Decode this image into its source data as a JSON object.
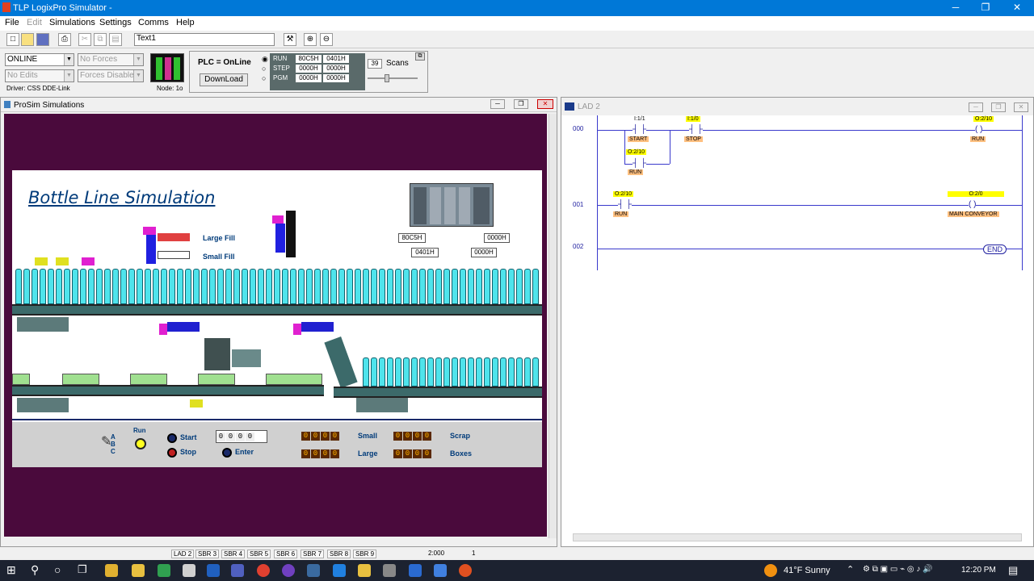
{
  "window": {
    "title": "TLP LogixPro Simulator  -"
  },
  "menu": [
    "File",
    "Edit",
    "Simulations",
    "Settings",
    "Comms",
    "Help"
  ],
  "toolbar": {
    "text_field": "Text1"
  },
  "status": {
    "mode": "ONLINE",
    "forces": "No Forces",
    "edits": "No Edits",
    "forces_disabled": "Forces Disabled",
    "driver": "Driver: CSS DDE-Link",
    "node": "Node: 1o",
    "plc": "PLC = OnLine",
    "download": "DownLoad",
    "run": "RUN",
    "step": "STEP",
    "pgm": "PGM",
    "hex": [
      "80C5H",
      "0401H",
      "0000H",
      "0000H",
      "0000H",
      "0000H"
    ],
    "scans_value": "39",
    "scans_label": "Scans"
  },
  "prosim": {
    "title": "ProSim Simulations",
    "sim_title": "Bottle Line Simulation",
    "large_fill": "Large Fill",
    "small_fill": "Small Fill",
    "plc_hex": [
      "80C5H",
      "0000H",
      "0401H",
      "0000H"
    ],
    "panel": {
      "run": "Run",
      "start": "Start",
      "stop": "Stop",
      "enter": "Enter",
      "small": "Small",
      "large": "Large",
      "scrap": "Scrap",
      "boxes": "Boxes",
      "abc": [
        "A",
        "B",
        "C"
      ],
      "thumbwheel": [
        "0",
        "0",
        "0",
        "0"
      ],
      "small_count": [
        "0",
        "0",
        "0",
        "0"
      ],
      "large_count": [
        "0",
        "0",
        "0",
        "0"
      ],
      "scrap_count": [
        "0",
        "0",
        "0",
        "0"
      ],
      "boxes_count": [
        "0",
        "0",
        "0",
        "0"
      ]
    }
  },
  "ladder": {
    "title": "LAD 2",
    "rungs": [
      "000",
      "001",
      "002"
    ],
    "r0": {
      "start_addr": "I:1/1",
      "start": "START",
      "stop_addr": "I:1/0",
      "stop": "STOP",
      "seal_addr": "O:2/10",
      "seal": "RUN",
      "coil_addr": "O:2/10",
      "coil": "RUN"
    },
    "r1": {
      "c_addr": "O:2/10",
      "c": "RUN",
      "coil_addr": "O:2/0",
      "coil": "MAIN CONVEYOR"
    },
    "end": "END"
  },
  "tabs": [
    "LAD 2",
    "SBR 3",
    "SBR 4",
    "SBR 5",
    "SBR 6",
    "SBR 7",
    "SBR 8",
    "SBR 9"
  ],
  "statusbar": {
    "address": "2:000",
    "value": "1"
  },
  "taskbar": {
    "weather": "41°F  Sunny",
    "time": "12:20 PM"
  }
}
